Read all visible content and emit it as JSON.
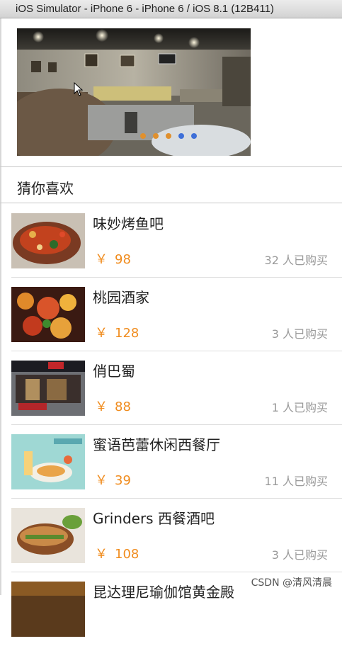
{
  "window": {
    "title": "iOS Simulator - iPhone 6 - iPhone 6 / iOS 8.1 (12B411)"
  },
  "banner": {
    "image": "restaurant-interior-photo",
    "page_dots": [
      "#e0902e",
      "#e0902e",
      "#e0902e",
      "#3e6fd8",
      "#3e6fd8"
    ]
  },
  "section": {
    "title": "猜你喜欢"
  },
  "deals": [
    {
      "name": "味妙烤鱼吧",
      "currency": "￥",
      "price": "98",
      "sold": "32 人已购买",
      "thumb": "grilled-fish-photo"
    },
    {
      "name": "桃园酒家",
      "currency": "￥",
      "price": "128",
      "sold": "3 人已购买",
      "thumb": "seafood-dish-photo"
    },
    {
      "name": "俏巴蜀",
      "currency": "￥",
      "price": "88",
      "sold": "1 人已购买",
      "thumb": "restaurant-storefront-photo"
    },
    {
      "name": "蜜语芭蕾休闲西餐厅",
      "currency": "￥",
      "price": "39",
      "sold": "11 人已购买",
      "thumb": "western-meal-photo"
    },
    {
      "name": "Grinders 西餐酒吧",
      "currency": "￥",
      "price": "108",
      "sold": "3 人已购买",
      "thumb": "sandwich-photo"
    },
    {
      "name": "昆达理尼瑜伽馆黄金殿",
      "currency": "",
      "price": "",
      "sold": "",
      "thumb": "yoga-hall-photo"
    }
  ],
  "watermark": "CSDN @清风清晨",
  "colors": {
    "price": "#f08c1e",
    "sold": "#9a9a9a",
    "title_bar": "#dcdcdc"
  }
}
